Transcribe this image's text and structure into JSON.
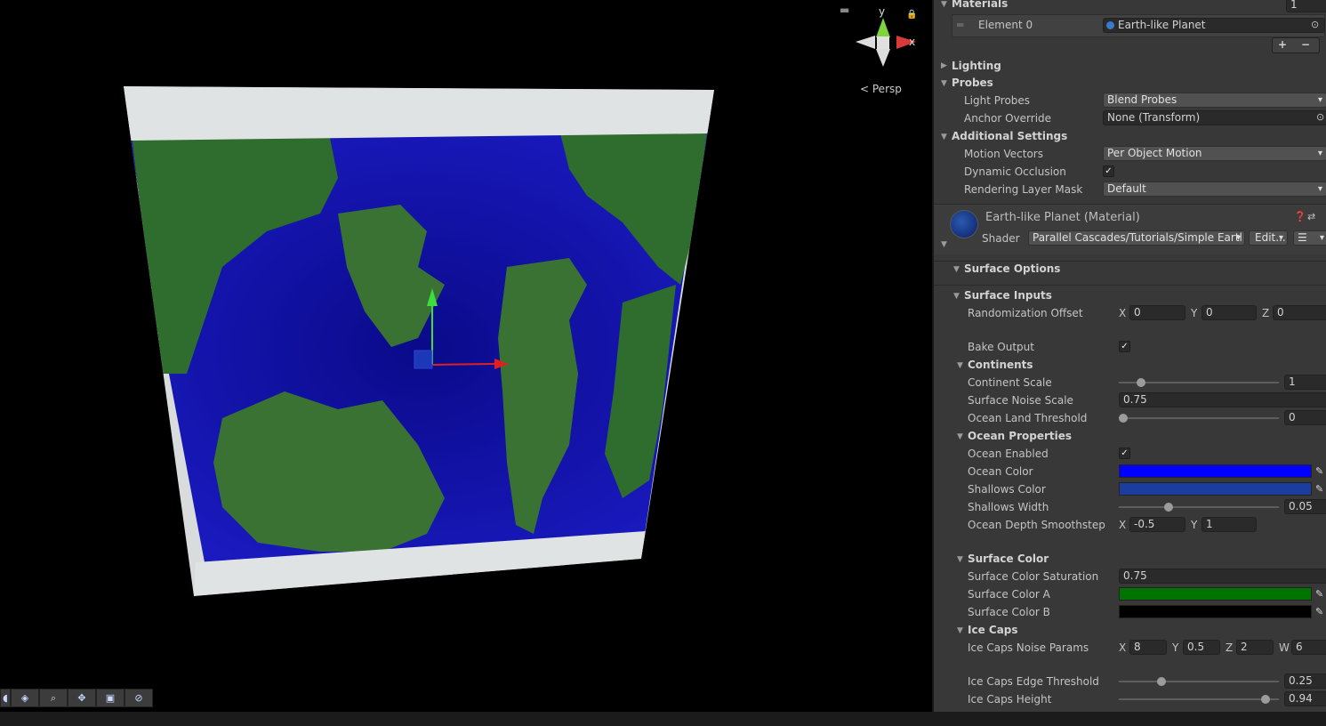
{
  "scene": {
    "view_label": "Persp",
    "axis_y": "y",
    "axis_x": "x"
  },
  "overlay_icons": [
    "globe-icon",
    "layers-icon",
    "zoom-icon",
    "move-icon",
    "camera-icon",
    "compass-icon"
  ],
  "inspector": {
    "materials": {
      "label": "Materials",
      "count": "1",
      "element_label": "Element 0",
      "element_value": "Earth-like Planet"
    },
    "lighting_label": "Lighting",
    "probes": {
      "label": "Probes",
      "light_probes_label": "Light Probes",
      "light_probes_value": "Blend Probes",
      "anchor_label": "Anchor Override",
      "anchor_value": "None (Transform)"
    },
    "additional": {
      "label": "Additional Settings",
      "motion_label": "Motion Vectors",
      "motion_value": "Per Object Motion",
      "dynamic_label": "Dynamic Occlusion",
      "layer_label": "Rendering Layer Mask",
      "layer_value": "Default"
    },
    "material": {
      "title": "Earth-like Planet (Material)",
      "shader_label": "Shader",
      "shader_value": "Parallel Cascades/Tutorials/Simple Eartl",
      "edit_label": "Edit..."
    },
    "surface_options_label": "Surface Options",
    "surface_inputs": {
      "label": "Surface Inputs",
      "rand_label": "Randomization Offset",
      "rand_x": "0",
      "rand_y": "0",
      "rand_z": "0",
      "bake_label": "Bake Output"
    },
    "continents": {
      "label": "Continents",
      "scale_label": "Continent Scale",
      "scale_value": "1",
      "scale_level": 0.12,
      "noise_label": "Surface Noise Scale",
      "noise_value": "0.75",
      "threshold_label": "Ocean Land Threshold",
      "threshold_value": "0",
      "threshold_level": 0.0
    },
    "ocean": {
      "label": "Ocean Properties",
      "enabled_label": "Ocean Enabled",
      "color_label": "Ocean Color",
      "color": "#0000ff",
      "shallows_label": "Shallows Color",
      "shallows_color": "#1a3d9e",
      "width_label": "Shallows Width",
      "width_value": "0.05",
      "width_level": 0.3,
      "depth_label": "Ocean Depth Smoothstep",
      "depth_x": "-0.5",
      "depth_y": "1"
    },
    "surface_color": {
      "label": "Surface Color",
      "sat_label": "Surface Color Saturation",
      "sat_value": "0.75",
      "a_label": "Surface Color A",
      "a_color": "#007300",
      "b_label": "Surface Color B",
      "b_color": "#000000"
    },
    "ice": {
      "label": "Ice Caps",
      "noise_label": "Ice Caps Noise Params",
      "x": "8",
      "y": "0.5",
      "z": "2",
      "w": "6",
      "edge_label": "Ice Caps Edge Threshold",
      "edge_value": "0.25",
      "edge_level": 0.25,
      "height_label": "Ice Caps Height",
      "height_value": "0.94",
      "height_level": 0.94
    }
  }
}
